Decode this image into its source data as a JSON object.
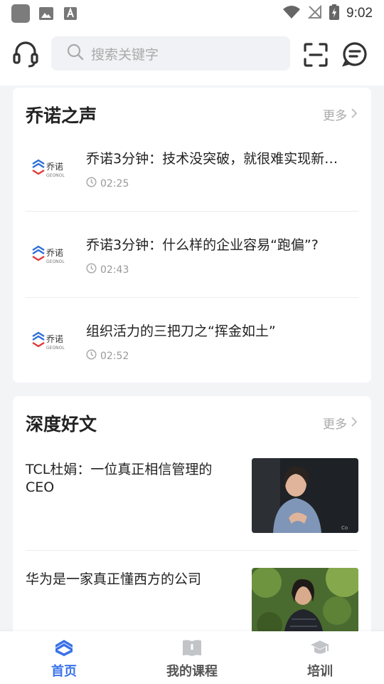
{
  "status": {
    "time": "9:02"
  },
  "search": {
    "placeholder": "搜索关键字"
  },
  "voice": {
    "title": "乔诺之声",
    "more": "更多",
    "logo_text": "乔诺",
    "logo_sub": "GEONOL",
    "items": [
      {
        "title": "乔诺3分钟：技术没突破，就很难实现新…",
        "duration": "02:25"
      },
      {
        "title": "乔诺3分钟：什么样的企业容易“跑偏”?",
        "duration": "02:43"
      },
      {
        "title": "组织活力的三把刀之“挥金如土”",
        "duration": "02:52"
      }
    ]
  },
  "articles": {
    "title": "深度好文",
    "more": "更多",
    "items": [
      {
        "title": "TCL杜娟：一位真正相信管理的CEO"
      },
      {
        "title": "华为是一家真正懂西方的公司"
      }
    ]
  },
  "nav": {
    "tabs": [
      {
        "label": "首页",
        "active": true
      },
      {
        "label": "我的课程",
        "active": false
      },
      {
        "label": "培训",
        "active": false
      }
    ]
  },
  "colors": {
    "accent": "#3a73e8",
    "inactive": "#555555",
    "logo_blue": "#2f6fd8",
    "logo_red": "#e03a3a"
  }
}
